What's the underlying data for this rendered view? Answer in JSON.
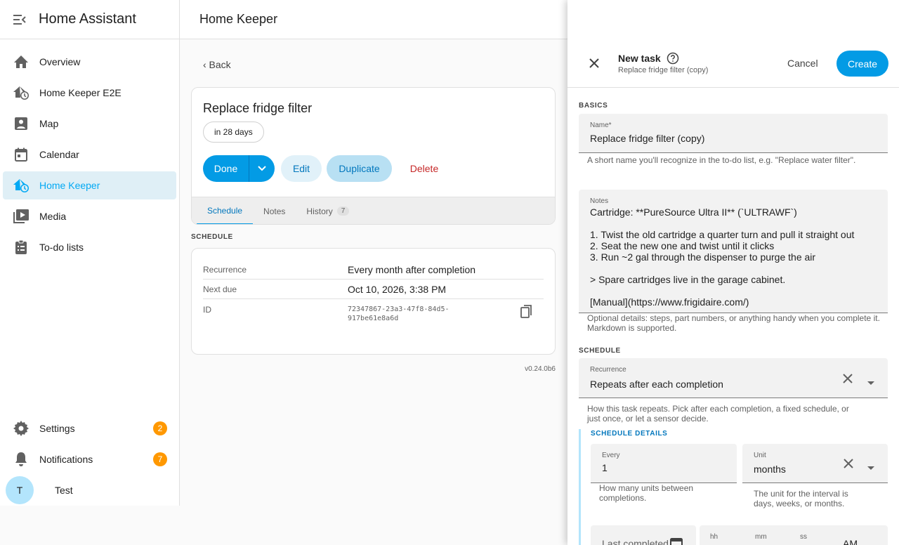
{
  "app": {
    "title": "Home Assistant"
  },
  "sidebar": {
    "items": [
      {
        "label": "Overview",
        "icon": "home-icon"
      },
      {
        "label": "Home Keeper E2E",
        "icon": "home-clock-icon"
      },
      {
        "label": "Map",
        "icon": "map-icon"
      },
      {
        "label": "Calendar",
        "icon": "calendar-icon"
      },
      {
        "label": "Home Keeper",
        "icon": "home-clock-icon",
        "active": true
      },
      {
        "label": "Media",
        "icon": "media-icon"
      },
      {
        "label": "To-do lists",
        "icon": "clipboard-list-icon"
      }
    ],
    "settings": {
      "label": "Settings",
      "badge": "2"
    },
    "notifications": {
      "label": "Notifications",
      "badge": "7"
    },
    "user": {
      "initial": "T",
      "name": "Test"
    }
  },
  "page": {
    "title": "Home Keeper",
    "back": "‹ Back",
    "task": {
      "title": "Replace fridge filter",
      "due_chip": "in 28 days",
      "actions": {
        "done": "Done",
        "edit": "Edit",
        "duplicate": "Duplicate",
        "delete": "Delete"
      },
      "tabs": {
        "schedule": "Schedule",
        "notes": "Notes",
        "history": "History",
        "history_count": "7"
      }
    },
    "schedule_section": "SCHEDULE",
    "schedule": {
      "recurrence_label": "Recurrence",
      "recurrence_value": "Every month after completion",
      "next_due_label": "Next due",
      "next_due_value": "Oct 10, 2026, 3:38 PM",
      "id_label": "ID",
      "id_value_line1": "72347867-23a3-47f8-84d5-",
      "id_value_line2": "917be61e8a6d"
    },
    "version": "v0.24.0b6"
  },
  "dialog": {
    "title": "New task",
    "subtitle": "Replace fridge filter (copy)",
    "cancel": "Cancel",
    "create": "Create",
    "basics_label": "BASICS",
    "name_label": "Name*",
    "name_value": "Replace fridge filter (copy)",
    "name_help": "A short name you'll recognize in the to-do list, e.g. \"Replace water filter\".",
    "notes_label": "Notes",
    "notes_value": "Cartridge: **PureSource Ultra II** (`ULTRAWF`)\n\n1. Twist the old cartridge a quarter turn and pull it straight out\n2. Seat the new one and twist until it clicks\n3. Run ~2 gal through the dispenser to purge the air\n\n> Spare cartridges live in the garage cabinet.\n\n[Manual](https://www.frigidaire.com/)",
    "notes_help_1": "Optional details: steps, part numbers, or anything handy when you complete it.",
    "notes_help_2": "Markdown is supported.",
    "schedule_label": "SCHEDULE",
    "recurrence_label": "Recurrence",
    "recurrence_value": "Repeats after each completion",
    "recurrence_help_1": "How this task repeats. Pick after each completion, a fixed schedule, or",
    "recurrence_help_2": "just once, or let a sensor decide.",
    "details_label": "SCHEDULE DETAILS",
    "every_label": "Every",
    "every_value": "1",
    "every_help_1": "How many units between",
    "every_help_2": "completions.",
    "unit_label": "Unit",
    "unit_value": "months",
    "unit_help_1": "The unit for the interval is",
    "unit_help_2": "days, weeks, or months.",
    "last_completed_label": "Last completed",
    "time_hh": "hh",
    "time_mm": "mm",
    "time_ss": "ss",
    "time_ampm": "AM"
  }
}
